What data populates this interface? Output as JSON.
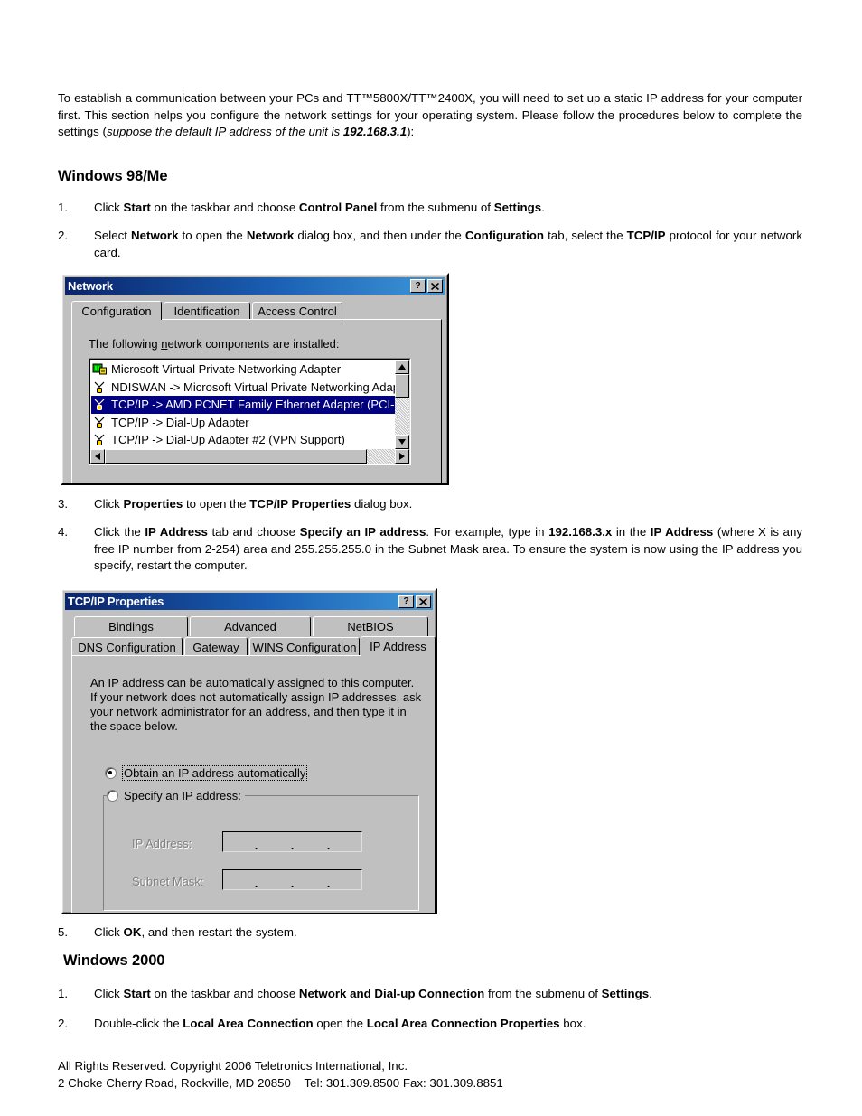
{
  "document": {
    "intro": {
      "part1": "To establish a communication between your PCs and TT™5800X/TT™2400X, you will need to set up a static IP address for your computer first. This section helps you configure the network settings for your operating system. Please follow the procedures below to complete the settings (",
      "italic": "suppose the default IP address of the unit is ",
      "italic_bold": "192.168.3.1",
      "part2": "):"
    },
    "heading_win98": "Windows 98/Me",
    "heading_win2000": "Windows 2000",
    "steps_win98": [
      {
        "num": "1."
      },
      {
        "num": "2."
      },
      {
        "num": "3."
      },
      {
        "num": "4."
      },
      {
        "num": "5."
      }
    ],
    "step1": {
      "t1": "Click ",
      "b1": "Start",
      "t2": " on the taskbar and choose ",
      "b2": "Control Panel",
      "t3": " from the submenu of ",
      "b3": "Settings",
      "t4": "."
    },
    "step2": {
      "t1": "Select ",
      "b1": "Network",
      "t2": " to open the ",
      "b2": "Network",
      "t3": " dialog box, and then under the ",
      "b3": "Configuration",
      "t4": " tab, select the ",
      "b4": "TCP/IP",
      "t5": " protocol for your network card."
    },
    "step3": {
      "t1": "Click ",
      "b1": "Properties",
      "t2": " to open the ",
      "b2": "TCP/IP Properties",
      "t3": " dialog box."
    },
    "step4": {
      "t1": "Click the ",
      "b1": "IP Address",
      "t2": " tab and choose ",
      "b2": "Specify an IP address",
      "t3": ". For example, type in ",
      "b3": "192.168.3.x",
      "t4": " in the ",
      "b4": "IP Address",
      "t5": " (where X is any free IP number from 2-254) area and 255.255.255.0 in the Subnet Mask area. To ensure the system is now using the IP address you specify, restart the computer."
    },
    "step5": {
      "t1": "Click ",
      "b1": "OK",
      "t2": ", and then restart the system."
    },
    "w2k_step1": {
      "num": "1.",
      "t1": "Click ",
      "b1": "Start",
      "t2": " on the taskbar and choose ",
      "b2": "Network and Dial-up Connection",
      "t3": " from the submenu of ",
      "b3": "Settings",
      "t4": "."
    },
    "w2k_step2": {
      "num": "2.",
      "t1": "Double-click the ",
      "b1": "Local Area Connection",
      "t2": " open the ",
      "b2": "Local Area Connection Properties",
      "t3": " box."
    },
    "footer": {
      "line1": "All Rights Reserved. Copyright 2006 Teletronics International, Inc.",
      "line2": "2 Choke Cherry Road, Rockville, MD 20850    Tel: 301.309.8500 Fax: 301.309.8851"
    }
  },
  "network_dialog": {
    "title": "Network",
    "titlebar_buttons": {
      "help": "?",
      "close": "x"
    },
    "tabs": [
      {
        "label": "Configuration",
        "active": true
      },
      {
        "label": "Identification",
        "active": false
      },
      {
        "label": "Access Control",
        "active": false
      }
    ],
    "list_caption_pre": "The following ",
    "list_caption_accel": "n",
    "list_caption_post": "etwork components are installed:",
    "components": [
      {
        "label": "Microsoft Virtual Private Networking Adapter",
        "icon": "network-adapter-icon",
        "selected": false
      },
      {
        "label": "NDISWAN -> Microsoft Virtual Private Networking Adapte",
        "icon": "protocol-icon",
        "selected": false
      },
      {
        "label": "TCP/IP -> AMD PCNET Family Ethernet Adapter (PCI-ISA",
        "icon": "protocol-icon",
        "selected": true
      },
      {
        "label": "TCP/IP -> Dial-Up Adapter",
        "icon": "protocol-icon",
        "selected": false
      },
      {
        "label": "TCP/IP -> Dial-Up Adapter #2 (VPN Support)",
        "icon": "protocol-icon",
        "selected": false
      }
    ],
    "selection_color": "#000080",
    "titlebar_color": "#0a246a",
    "face_color": "#c0c0c0"
  },
  "tcpip_dialog": {
    "title": "TCP/IP Properties",
    "titlebar_buttons": {
      "help": "?",
      "close": "x"
    },
    "tabs_row1": [
      {
        "label": "Bindings",
        "active": false
      },
      {
        "label": "Advanced",
        "active": false
      },
      {
        "label": "NetBIOS",
        "active": false
      }
    ],
    "tabs_row2": [
      {
        "label": "DNS Configuration",
        "active": false
      },
      {
        "label": "Gateway",
        "active": false
      },
      {
        "label": "WINS Configuration",
        "active": false
      },
      {
        "label": "IP Address",
        "active": true
      }
    ],
    "description": [
      "An IP address can be automatically assigned to this computer.",
      "If your network does not automatically assign IP addresses, ask",
      "your network administrator for an address, and then type it in",
      "the space below."
    ],
    "radio_auto": {
      "label": "Obtain an IP address automatically",
      "checked": true,
      "focused": true
    },
    "radio_specify": {
      "label": "Specify an IP address:",
      "checked": false
    },
    "fields": [
      {
        "label": "IP Address:",
        "value": "",
        "disabled": true,
        "octets": [
          "",
          "",
          "",
          ""
        ]
      },
      {
        "label": "Subnet Mask:",
        "value": "",
        "disabled": true,
        "octets": [
          "",
          "",
          "",
          ""
        ]
      }
    ],
    "dot_separator": "."
  }
}
